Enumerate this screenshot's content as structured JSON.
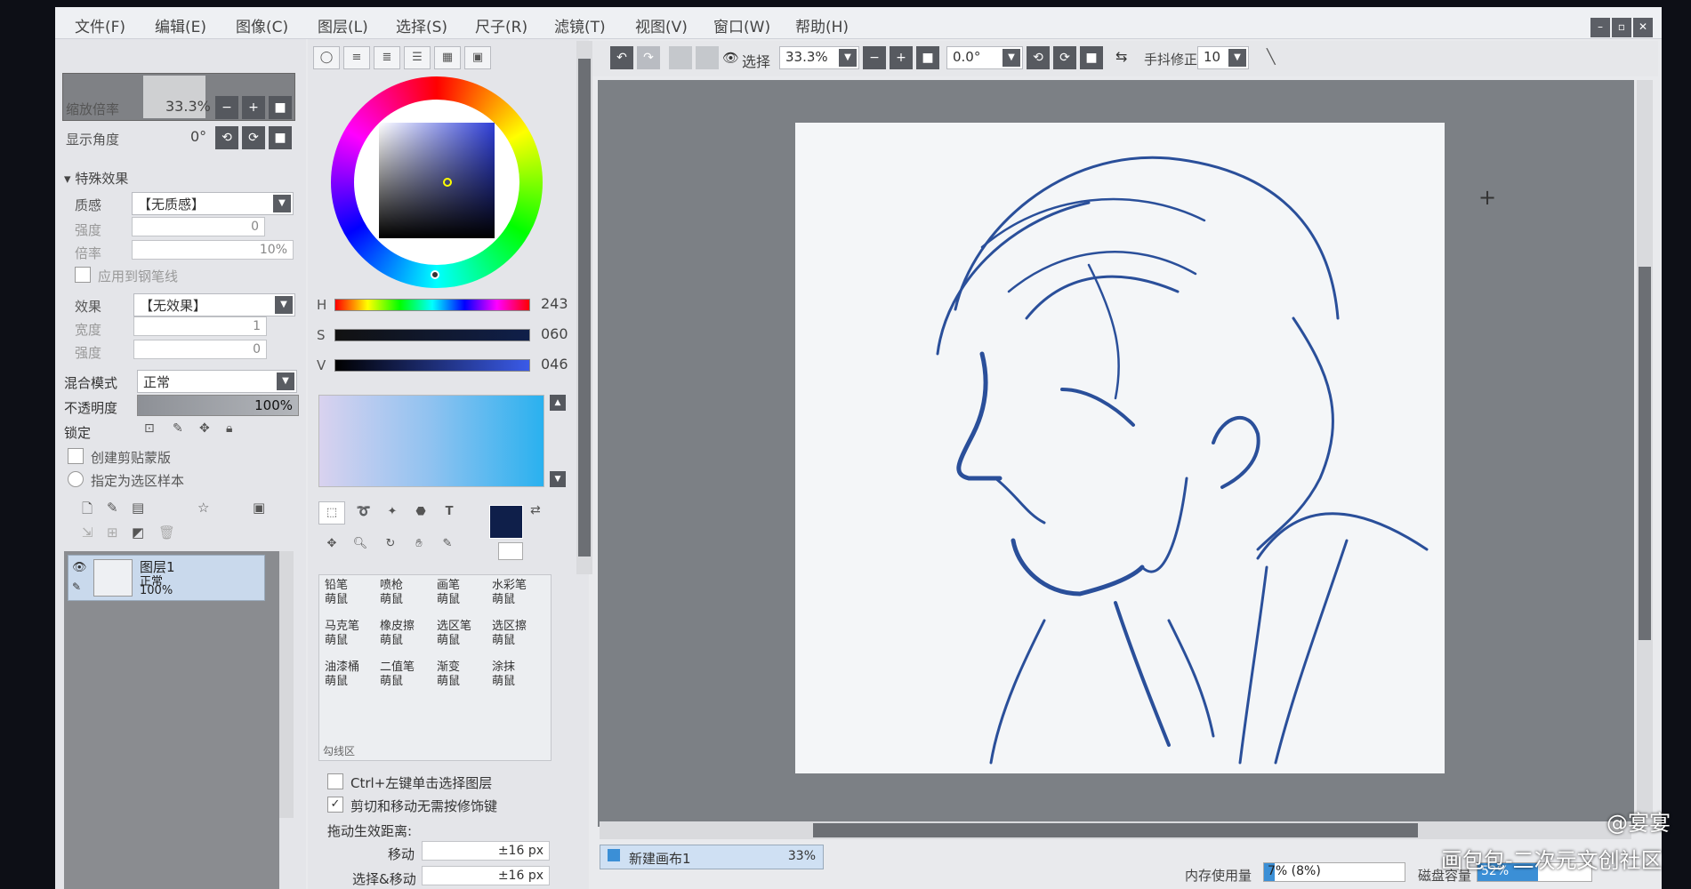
{
  "menu": [
    "文件(F)",
    "编辑(E)",
    "图像(C)",
    "图层(L)",
    "选择(S)",
    "尺子(R)",
    "滤镜(T)",
    "视图(V)",
    "窗口(W)",
    "帮助(H)"
  ],
  "window_controls": [
    "–",
    "▫",
    "✕"
  ],
  "navigator": {
    "zoom_label": "缩放倍率",
    "zoom_value": "33.3%",
    "angle_label": "显示角度",
    "angle_value": "0°"
  },
  "effects": {
    "section_label": "特殊效果",
    "texture_label": "质感",
    "texture_value": "【无质感】",
    "strength_label": "强度",
    "strength_value": "0",
    "scale_label": "倍率",
    "scale_value": "10%",
    "apply_pen_label": "应用到钢笔线",
    "effect_label": "效果",
    "effect_value": "【无效果】",
    "width_label": "宽度",
    "width_value": "1",
    "strength2_label": "强度",
    "strength2_value": "0"
  },
  "layer_props": {
    "blend_label": "混合模式",
    "blend_value": "正常",
    "opacity_label": "不透明度",
    "opacity_value": "100%",
    "lock_label": "锁定",
    "clipping_label": "创建剪贴蒙版",
    "selection_sample_label": "指定为选区样本"
  },
  "layer": {
    "name": "图层1",
    "mode": "正常",
    "opacity": "100%"
  },
  "color": {
    "h_label": "H",
    "h_value": "243",
    "s_label": "S",
    "s_value": "060",
    "v_label": "V",
    "v_value": "046",
    "current": "#0f1f4a"
  },
  "tools": [
    {
      "name": "铅笔",
      "sub": "萌鼠"
    },
    {
      "name": "喷枪",
      "sub": "萌鼠"
    },
    {
      "name": "画笔",
      "sub": "萌鼠"
    },
    {
      "name": "水彩笔",
      "sub": "萌鼠"
    },
    {
      "name": "马克笔",
      "sub": "萌鼠"
    },
    {
      "name": "橡皮擦",
      "sub": "萌鼠"
    },
    {
      "name": "选区笔",
      "sub": "萌鼠"
    },
    {
      "name": "选区擦",
      "sub": "萌鼠"
    },
    {
      "name": "油漆桶",
      "sub": "萌鼠"
    },
    {
      "name": "二值笔",
      "sub": "萌鼠"
    },
    {
      "name": "渐变",
      "sub": "萌鼠"
    },
    {
      "name": "涂抹",
      "sub": "萌鼠"
    }
  ],
  "tools_footer": "勾线区",
  "options": {
    "ctrl_click_label": "Ctrl+左键单击选择图层",
    "cut_move_label": "剪切和移动无需按修饰键",
    "drag_distance_label": "拖动生效距离:",
    "move_label": "移动",
    "move_value": "±16 px",
    "select_move_label": "选择&移动",
    "select_move_value": "±16 px"
  },
  "toolbar": {
    "select_label": "选择",
    "zoom_value": "33.3%",
    "angle_value": "0.0°",
    "stabilizer_label": "手抖修正",
    "stabilizer_value": "10"
  },
  "canvas_tab": {
    "name": "新建画布1",
    "zoom": "33%"
  },
  "status": {
    "memory_label": "内存使用量",
    "memory_value": "7% (8%)",
    "disk_label": "磁盘容量",
    "disk_value": "52%"
  },
  "watermarks": [
    "@宴宴",
    "画包包-二次元文创社区"
  ],
  "colors": {
    "accent": "#3b8fd6",
    "sketch_line": "#2a4f9a"
  }
}
